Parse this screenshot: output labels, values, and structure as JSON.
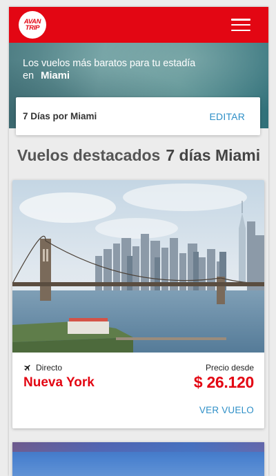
{
  "header": {
    "logo_line1": "AVAN",
    "logo_line2": "TRIP"
  },
  "hero": {
    "line1": "Los vuelos más baratos para tu estadía",
    "line2_prefix": "en",
    "city": "Miami"
  },
  "search": {
    "summary": "7 Días por Miami",
    "edit_label": "EDITAR"
  },
  "section": {
    "title": "Vuelos destacados",
    "title_bold": "7 días Miami"
  },
  "flights": [
    {
      "type": "Directo",
      "destination": "Nueva York",
      "price_label": "Precio desde",
      "price": "$ 26.120",
      "action_label": "VER VUELO"
    }
  ],
  "colors": {
    "brand_red": "#e30613",
    "link_blue": "#2e8fc7"
  },
  "icons": {
    "menu": "hamburger-icon",
    "flight": "airplane-icon"
  }
}
